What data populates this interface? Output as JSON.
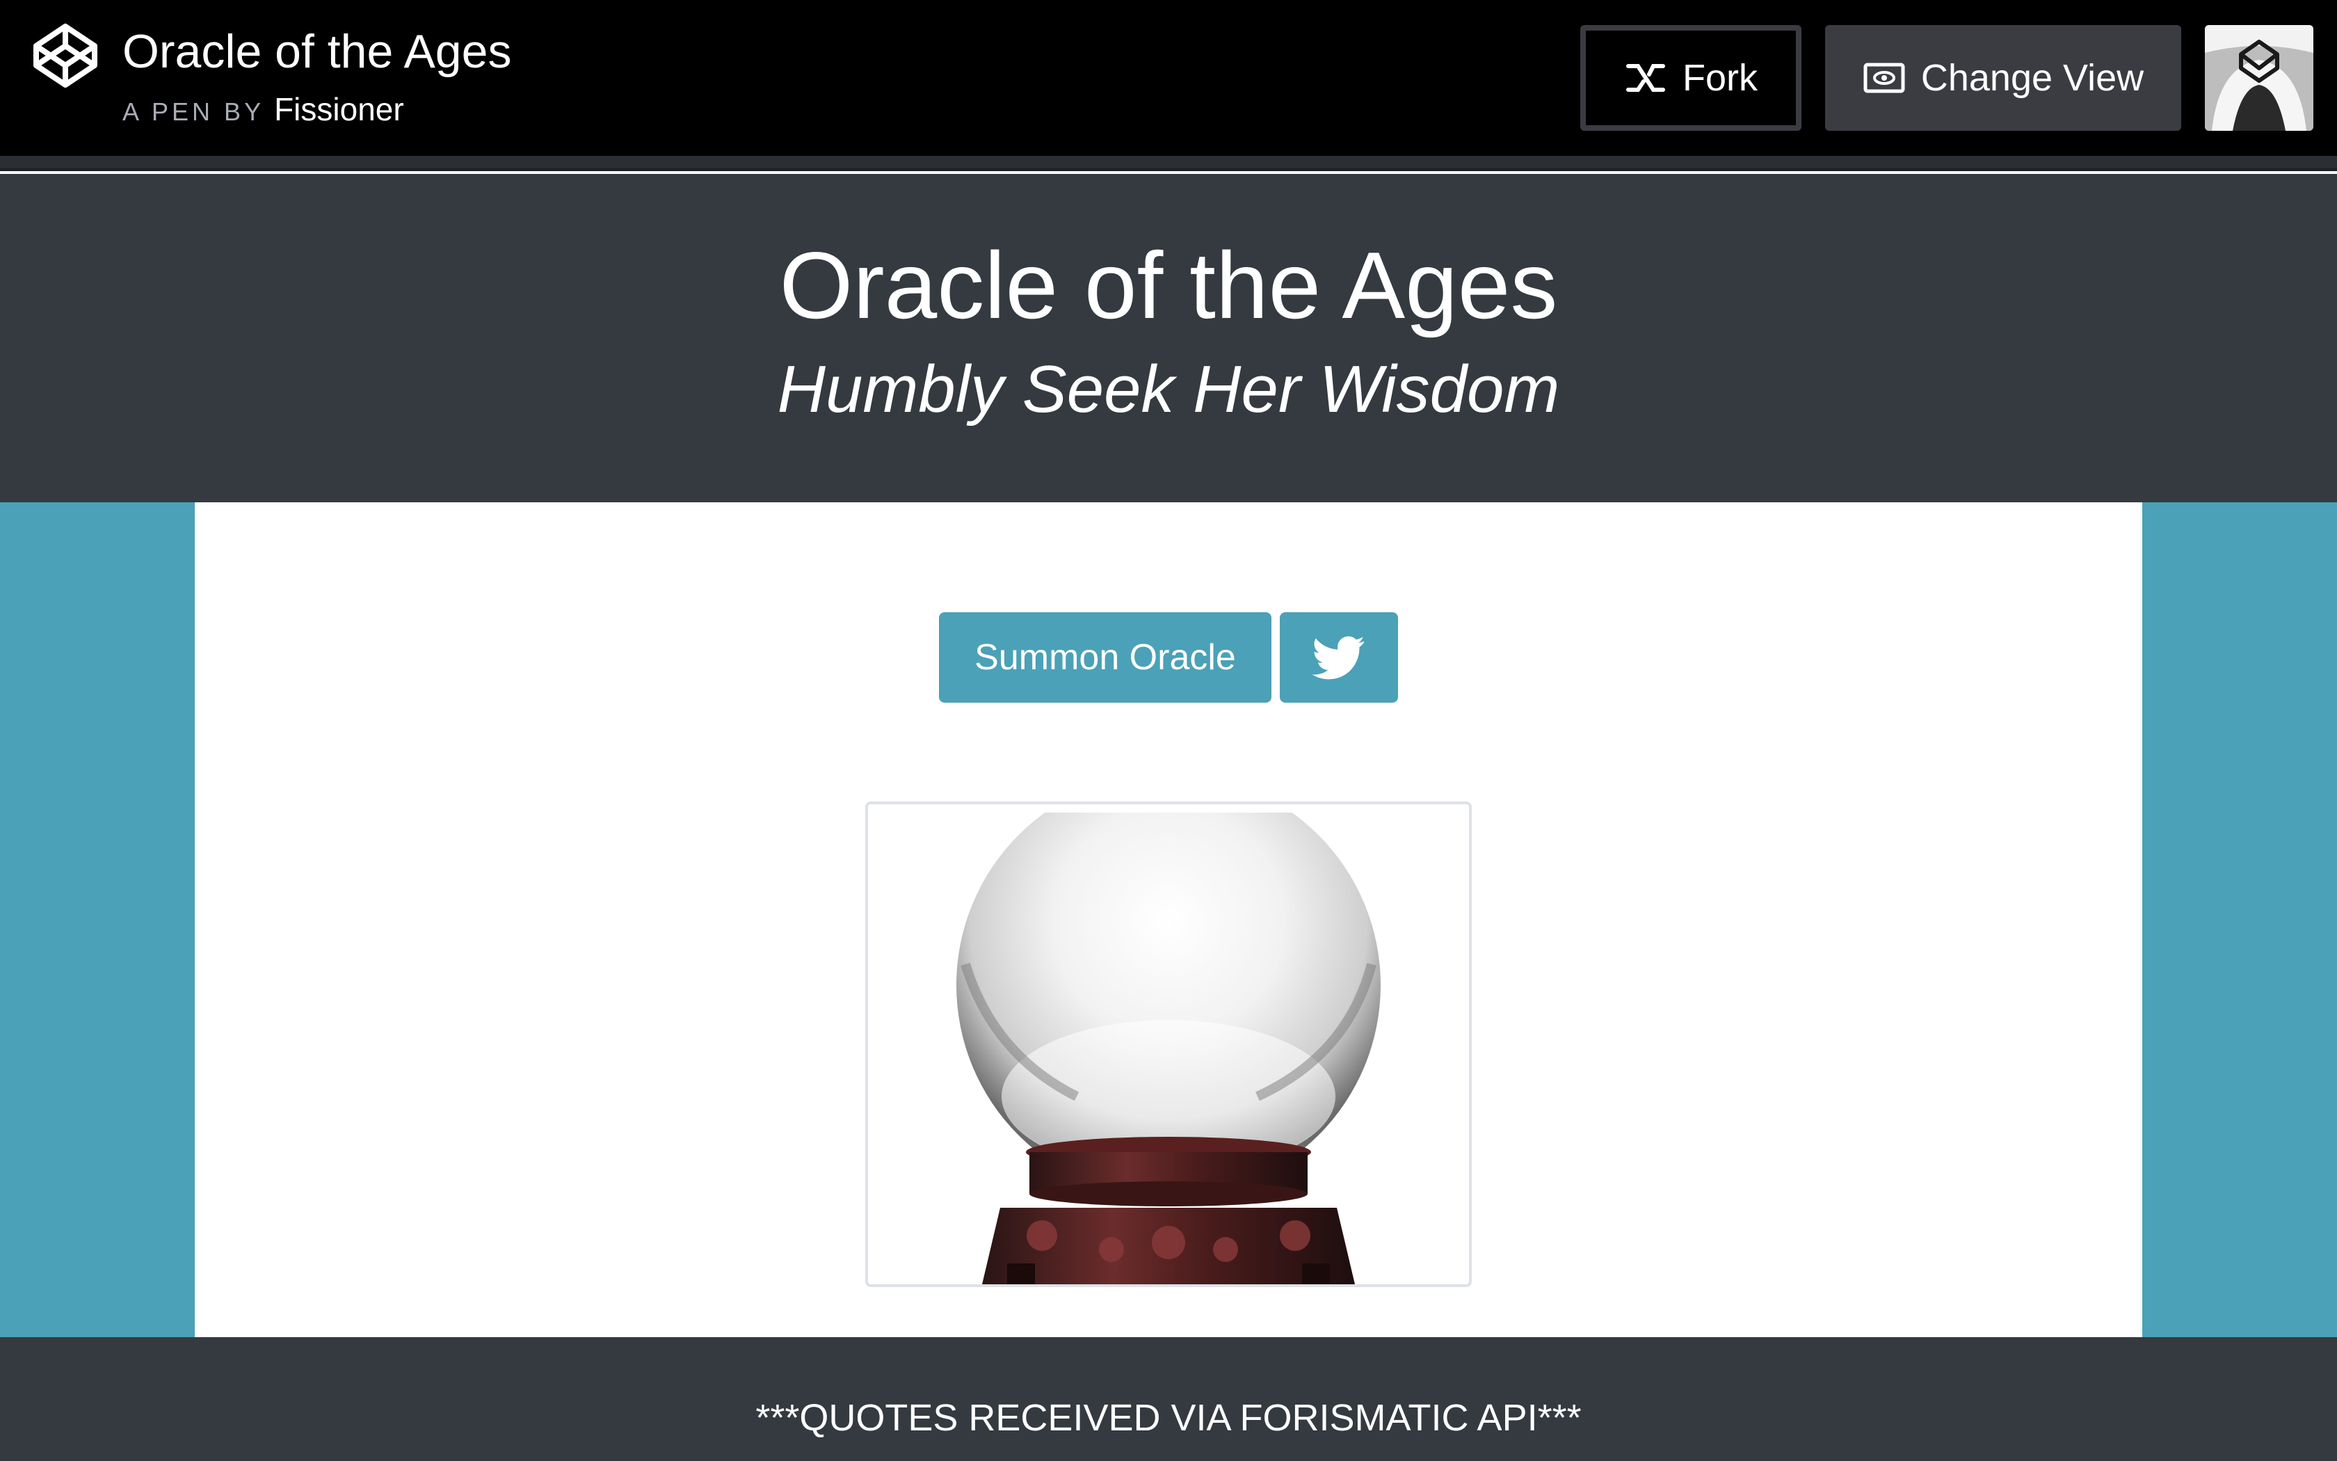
{
  "codepen": {
    "title": "Oracle of the Ages",
    "byline_prefix": "A PEN BY",
    "author": "Fissioner",
    "fork_label": "Fork",
    "change_view_label": "Change View"
  },
  "header": {
    "title": "Oracle of the Ages",
    "subtitle": "Humbly Seek Her Wisdom"
  },
  "main": {
    "summon_label": "Summon Oracle",
    "tweet_icon": "twitter-icon",
    "image_icon": "crystal-ball"
  },
  "footer": {
    "text": "***QUOTES RECEIVED VIA FORISMATIC API***"
  },
  "colors": {
    "accent": "#4ba1b7",
    "header_bg": "#343a40",
    "topbar_bg": "#000000"
  }
}
